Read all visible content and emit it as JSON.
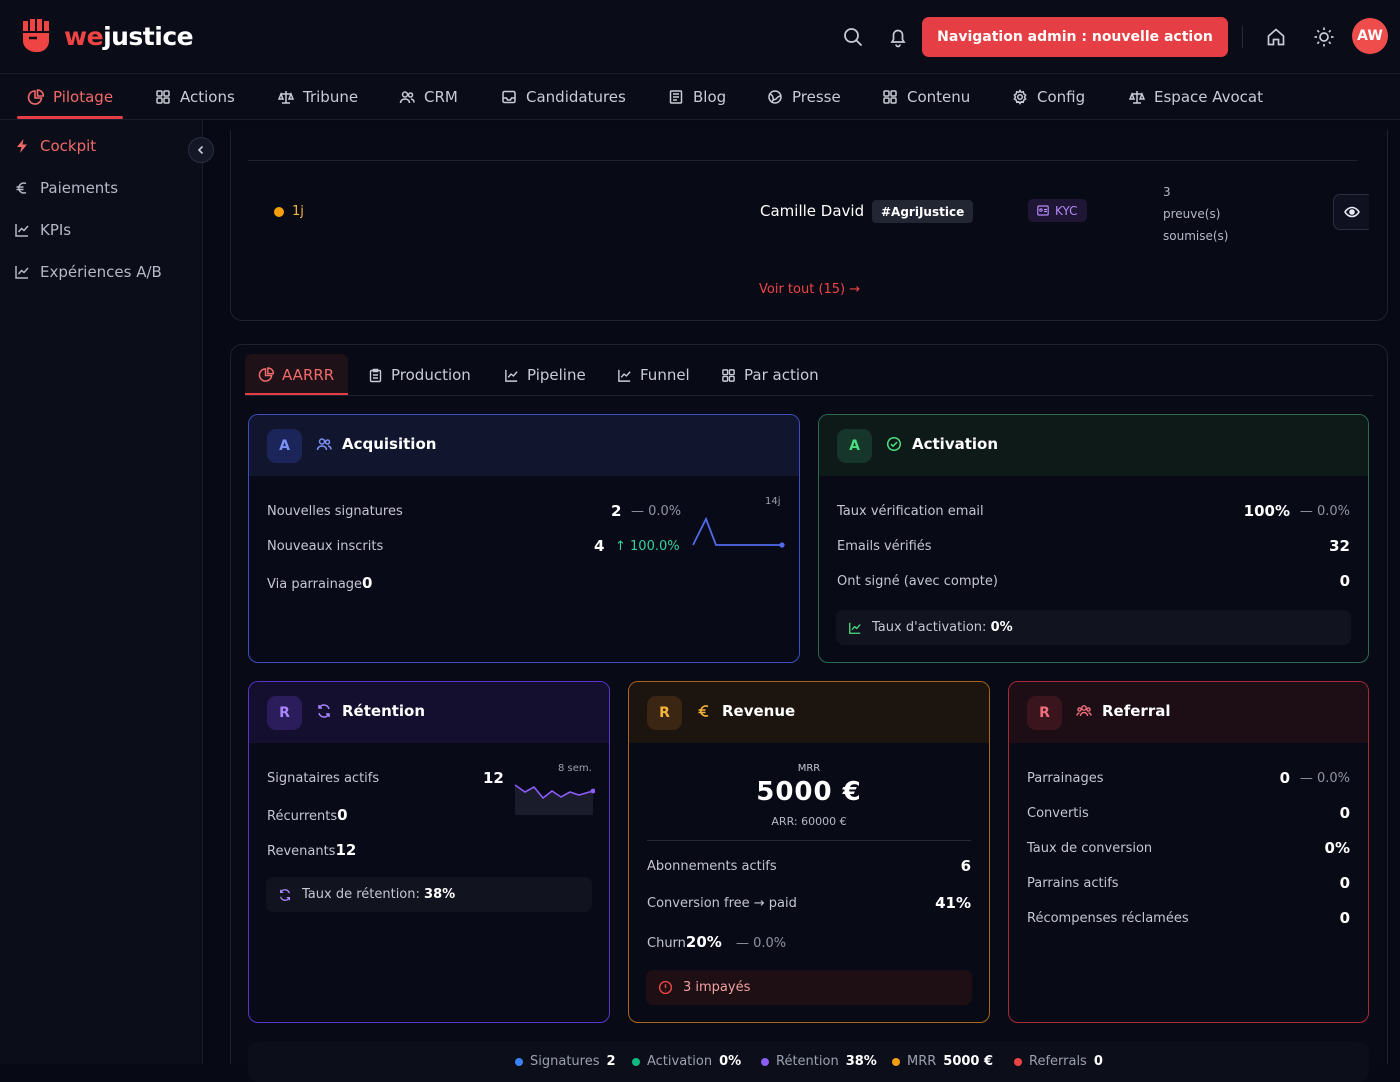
{
  "brand": {
    "name_part1": "we",
    "name_part2": "justice"
  },
  "header": {
    "cta_label": "Navigation admin : nouvelle action",
    "avatar_initials": "AW"
  },
  "nav": {
    "items": [
      {
        "label": "Pilotage",
        "icon": "pie-chart-icon"
      },
      {
        "label": "Actions",
        "icon": "grid-icon"
      },
      {
        "label": "Tribune",
        "icon": "scale-icon"
      },
      {
        "label": "CRM",
        "icon": "users-icon"
      },
      {
        "label": "Candidatures",
        "icon": "inbox-icon"
      },
      {
        "label": "Blog",
        "icon": "newspaper-icon"
      },
      {
        "label": "Presse",
        "icon": "globe-icon"
      },
      {
        "label": "Contenu",
        "icon": "grid-icon"
      },
      {
        "label": "Config",
        "icon": "gear-icon"
      },
      {
        "label": "Espace Avocat",
        "icon": "scale-icon"
      }
    ]
  },
  "sidebar": {
    "items": [
      {
        "label": "Cockpit",
        "icon": "bolt-icon"
      },
      {
        "label": "Paiements",
        "icon": "euro-icon"
      },
      {
        "label": "KPIs",
        "icon": "chart-line-icon"
      },
      {
        "label": "Expériences A/B",
        "icon": "chart-line-icon"
      }
    ]
  },
  "pending": {
    "age": "1j",
    "name": "Camille David",
    "tag": "#AgriJustice",
    "kyc": "KYC",
    "proofs_count": "3",
    "proofs_line1": "preuve(s)",
    "proofs_line2": "soumise(s)",
    "see_all": "Voir tout (15) →"
  },
  "tabs": [
    "AARRR",
    "Production",
    "Pipeline",
    "Funnel",
    "Par action"
  ],
  "acquisition": {
    "letter": "A",
    "title": "Acquisition",
    "spark_label": "14j",
    "r1_label": "Nouvelles signatures",
    "r1_value": "2",
    "r1_delta": "— 0.0%",
    "r2_label": "Nouveaux inscrits",
    "r2_value": "4",
    "r2_delta": "↑ 100.0%",
    "r3_label": "Via parrainage",
    "r3_value": "0"
  },
  "activation": {
    "letter": "A",
    "title": "Activation",
    "r1_label": "Taux vérification email",
    "r1_value": "100%",
    "r1_delta": "— 0.0%",
    "r2_label": "Emails vérifiés",
    "r2_value": "32",
    "r3_label": "Ont signé (avec compte)",
    "r3_value": "0",
    "rate_label": "Taux d'activation:",
    "rate_value": "0%"
  },
  "retention": {
    "letter": "R",
    "title": "Rétention",
    "spark_label": "8 sem.",
    "r1_label": "Signataires actifs",
    "r1_value": "12",
    "r2_label": "Récurrents",
    "r2_value": "0",
    "r3_label": "Revenants",
    "r3_value": "12",
    "rate_label": "Taux de rétention:",
    "rate_value": "38%"
  },
  "revenue": {
    "letter": "R",
    "title": "Revenue",
    "mrr_label": "MRR",
    "mrr_value": "5000 €",
    "arr": "ARR: 60000 €",
    "r1_label": "Abonnements actifs",
    "r1_value": "6",
    "r2_label": "Conversion free → paid",
    "r2_value": "41%",
    "r3_label": "Churn",
    "r3_value": "20%",
    "r3_delta": "— 0.0%",
    "alert": "3 impayés"
  },
  "referral": {
    "letter": "R",
    "title": "Referral",
    "r1_label": "Parrainages",
    "r1_value": "0",
    "r1_delta": "— 0.0%",
    "r2_label": "Convertis",
    "r2_value": "0",
    "r3_label": "Taux de conversion",
    "r3_value": "0%",
    "r4_label": "Parrains actifs",
    "r4_value": "0",
    "r5_label": "Récompenses réclamées",
    "r5_value": "0"
  },
  "legend": [
    {
      "label": "Signatures",
      "value": "2",
      "color": "#3b82f6"
    },
    {
      "label": "Activation",
      "value": "0%",
      "color": "#10b981"
    },
    {
      "label": "Rétention",
      "value": "38%",
      "color": "#8b5cf6"
    },
    {
      "label": "MRR",
      "value": "5000 €",
      "color": "#f59e0b"
    },
    {
      "label": "Referrals",
      "value": "0",
      "color": "#ef4444"
    }
  ],
  "colors": {
    "accent": "#e53e45",
    "acquisition": "#4f6bea",
    "activation": "#2b7a5a",
    "retention": "#6d3fd6",
    "revenue": "#c8741f",
    "referral": "#c83240"
  }
}
